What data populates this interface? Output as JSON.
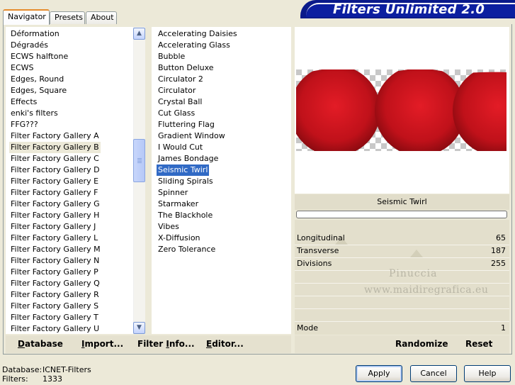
{
  "tabs": [
    "Navigator",
    "Presets",
    "About"
  ],
  "banner_title": "Filters Unlimited 2.0",
  "categories": [
    "Déformation",
    "Dégradés",
    "ECWS halftone",
    "ECWS",
    "Edges, Round",
    "Edges, Square",
    "Effects",
    "enki's filters",
    "FFG???",
    "Filter Factory Gallery A",
    "Filter Factory Gallery B",
    "Filter Factory Gallery C",
    "Filter Factory Gallery D",
    "Filter Factory Gallery E",
    "Filter Factory Gallery F",
    "Filter Factory Gallery G",
    "Filter Factory Gallery H",
    "Filter Factory Gallery J",
    "Filter Factory Gallery L",
    "Filter Factory Gallery M",
    "Filter Factory Gallery N",
    "Filter Factory Gallery P",
    "Filter Factory Gallery Q",
    "Filter Factory Gallery R",
    "Filter Factory Gallery S",
    "Filter Factory Gallery T",
    "Filter Factory Gallery U"
  ],
  "selected_category": "Filter Factory Gallery B",
  "filters": [
    "Accelerating Daisies",
    "Accelerating Glass",
    "Bubble",
    "Button Deluxe",
    "Circulator 2",
    "Circulator",
    "Crystal Ball",
    "Cut Glass",
    "Fluttering Flag",
    "Gradient Window",
    "I Would Cut",
    "James Bondage",
    "Seismic Twirl",
    "Sliding Spirals",
    "Spinner",
    "Starmaker",
    "The Blackhole",
    "Vibes",
    "X-Diffusion",
    "Zero Tolerance"
  ],
  "selected_filter": "Seismic Twirl",
  "left_buttons": {
    "database": {
      "pre": "",
      "u": "D",
      "post": "atabase"
    },
    "import": {
      "pre": "",
      "u": "I",
      "post": "mport..."
    },
    "filter_info": {
      "pre": "Filter ",
      "u": "I",
      "post": "nfo..."
    },
    "editor": {
      "pre": "",
      "u": "E",
      "post": "ditor..."
    }
  },
  "preview_filter_name": "Seismic Twirl",
  "sliders": [
    {
      "label": "Longitudinal",
      "value": "65",
      "level": 65
    },
    {
      "label": "Transverse",
      "value": "187",
      "level": 187
    },
    {
      "label": "Divisions",
      "value": "255",
      "level": 255
    }
  ],
  "mode": {
    "label": "Mode",
    "value": "1"
  },
  "watermark": [
    "Pinuccia",
    "www.maidiregrafica.eu"
  ],
  "randomize_label": "Randomize",
  "reset_label": "Reset",
  "status": {
    "database_label": "Database:",
    "database_value": "ICNET-Filters",
    "filters_label": "Filters:",
    "filters_value": "1333"
  },
  "dialog_buttons": {
    "apply": "Apply",
    "cancel": "Cancel",
    "help": "Help"
  },
  "colors": {
    "selection": "#316ac5",
    "preview_red": "#c0111a",
    "banner": "#0c1fa0"
  }
}
